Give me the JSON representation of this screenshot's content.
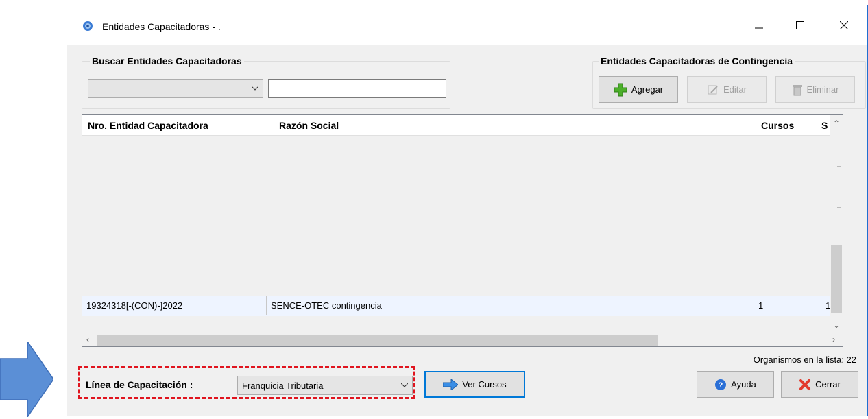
{
  "window": {
    "title": "Entidades Capacitadoras - .",
    "minimize_icon": "minimize-icon",
    "maximize_icon": "maximize-icon",
    "close_icon": "close-icon"
  },
  "search": {
    "group_title": "Buscar Entidades Capacitadoras",
    "combo_value": "",
    "text_value": ""
  },
  "contingency": {
    "group_title": "Entidades Capacitadoras de Contingencia",
    "add_label": "Agregar",
    "edit_label": "Editar",
    "delete_label": "Eliminar"
  },
  "grid": {
    "columns": [
      "Nro. Entidad Capacitadora",
      "Razón Social",
      "Cursos",
      "S"
    ],
    "rows": [
      [
        "19324318[-(CON)-]2022",
        "SENCE-OTEC contingencia",
        "1",
        "1"
      ]
    ]
  },
  "footer": {
    "count_text": "Organismos en la lista: 22",
    "linea_label": "Línea de Capacitación :",
    "linea_value": "Franquicia Tributaria",
    "ver_cursos_label": "Ver Cursos",
    "help_label": "Ayuda",
    "close_label": "Cerrar"
  },
  "colors": {
    "accent_arrow": "#5b8fd6",
    "highlight_dashed": "#e0141e",
    "window_border": "#1f6fd0"
  }
}
